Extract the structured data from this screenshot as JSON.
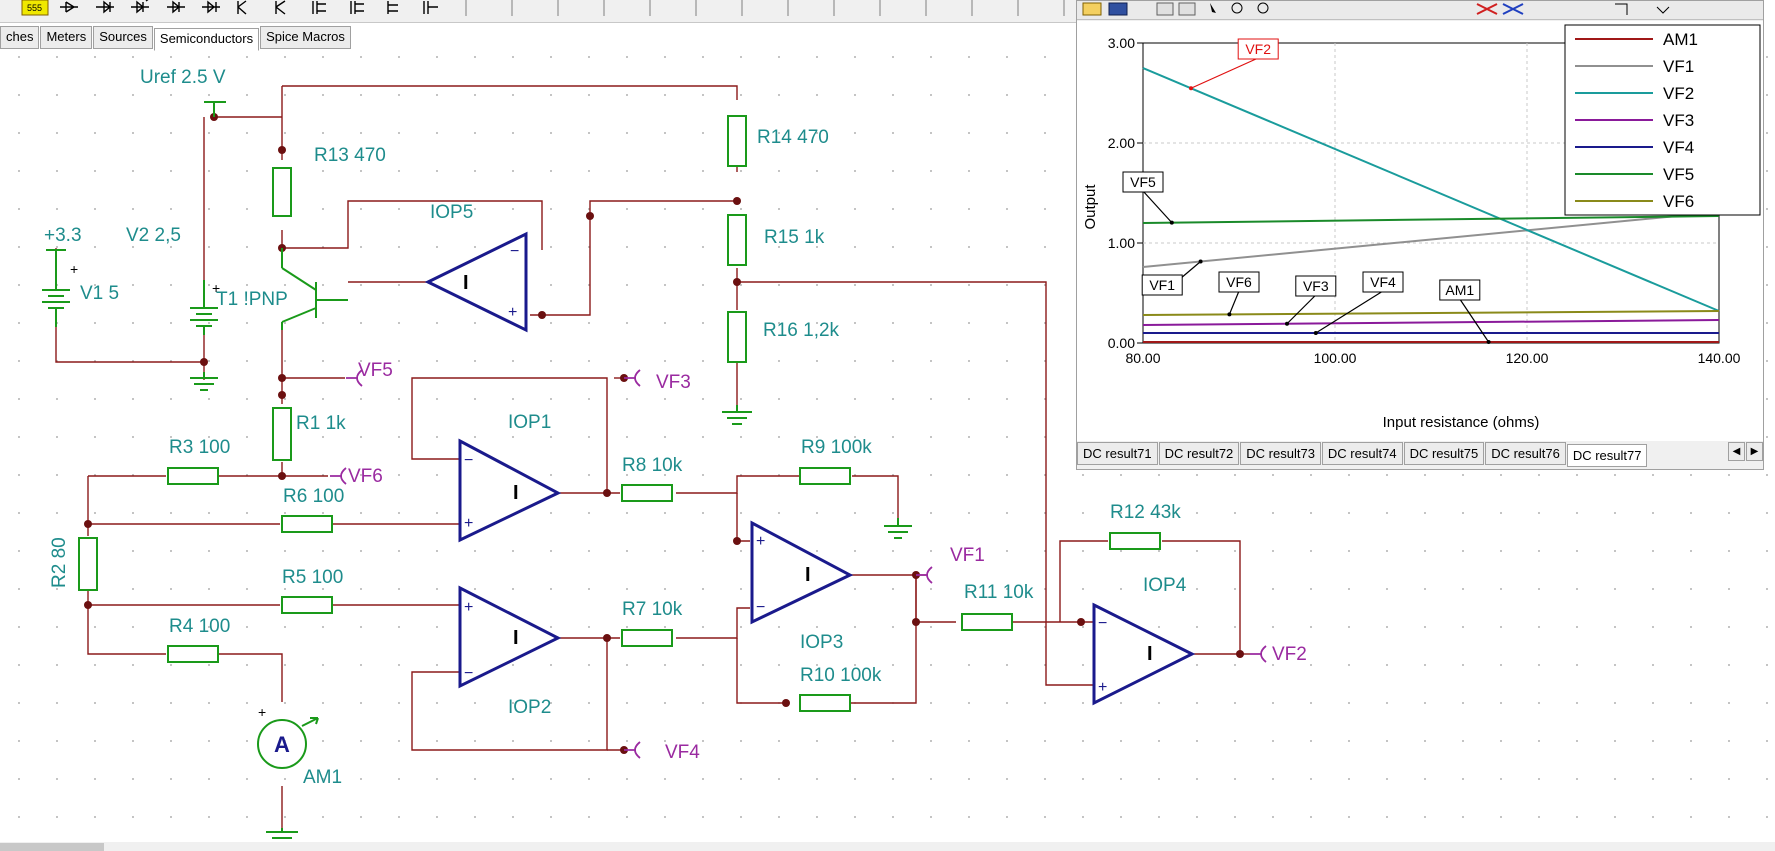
{
  "component_tabs": [
    "ches",
    "Meters",
    "Sources",
    "Semiconductors",
    "Spice Macros"
  ],
  "toolbar": {
    "badge": "555"
  },
  "schematic": {
    "components": {
      "uref": "Uref 2.5 V",
      "supply": "+3.3",
      "v1": "V1 5",
      "v2": "V2 2,5",
      "t1": "T1 !PNP",
      "r13": "R13 470",
      "r14": "R14 470",
      "r15": "R15 1k",
      "r16": "R16 1,2k",
      "r1": "R1 1k",
      "r3": "R3 100",
      "r6": "R6 100",
      "r5": "R5 100",
      "r4": "R4 100",
      "r2": "R2 80",
      "r8": "R8 10k",
      "r7": "R7 10k",
      "r9": "R9 100k",
      "r10": "R10 100k",
      "r11": "R11 10k",
      "r12": "R12 43k",
      "iop1": "IOP1",
      "iop2": "IOP2",
      "iop3": "IOP3",
      "iop4": "IOP4",
      "iop5": "IOP5",
      "am1": "AM1",
      "ammeter_symbol": "A",
      "opamp_symbol": "I"
    },
    "nets": {
      "vf1": "VF1",
      "vf2": "VF2",
      "vf3": "VF3",
      "vf4": "VF4",
      "vf5": "VF5",
      "vf6": "VF6"
    },
    "colors": {
      "wire": "#8b1a1a",
      "part": "#1a9a1a",
      "opamp": "#1a1a8c",
      "label": "#1e8c8c",
      "net": "#9a2aa0"
    }
  },
  "graph_window": {
    "result_tabs": [
      "DC result71",
      "DC result72",
      "DC result73",
      "DC result74",
      "DC result75",
      "DC result76",
      "DC result77"
    ],
    "active_tab": "DC result77",
    "nav": [
      "◀",
      "▶"
    ]
  },
  "chart_data": {
    "type": "line",
    "xlabel": "Input resistance (ohms)",
    "ylabel": "Output",
    "xlim": [
      80,
      140
    ],
    "ylim": [
      0,
      3
    ],
    "xticks": [
      "80.00",
      "100.00",
      "120.00",
      "140.00"
    ],
    "yticks": [
      "0.00",
      "1.00",
      "2.00",
      "3.00"
    ],
    "grid": true,
    "legend_position": "top-right",
    "series": [
      {
        "name": "AM1",
        "color": "#a01818",
        "x": [
          80,
          140
        ],
        "y": [
          0.01,
          0.01
        ]
      },
      {
        "name": "VF1",
        "color": "#909090",
        "x": [
          80,
          140
        ],
        "y": [
          0.76,
          1.31
        ]
      },
      {
        "name": "VF2",
        "color": "#1a9c9c",
        "x": [
          80,
          140
        ],
        "y": [
          2.75,
          0.32
        ]
      },
      {
        "name": "VF3",
        "color": "#8a1a9a",
        "x": [
          80,
          140
        ],
        "y": [
          0.18,
          0.23
        ]
      },
      {
        "name": "VF4",
        "color": "#1a1a8c",
        "x": [
          80,
          140
        ],
        "y": [
          0.1,
          0.1
        ]
      },
      {
        "name": "VF5",
        "color": "#1a8a2a",
        "x": [
          80,
          140
        ],
        "y": [
          1.2,
          1.27
        ]
      },
      {
        "name": "VF6",
        "color": "#8a8a1a",
        "x": [
          80,
          140
        ],
        "y": [
          0.28,
          0.32
        ]
      }
    ],
    "annotations": [
      {
        "text": "VF2",
        "style": "red"
      },
      {
        "text": "VF5",
        "style": "black"
      },
      {
        "text": "VF1",
        "style": "black"
      },
      {
        "text": "VF6",
        "style": "black"
      },
      {
        "text": "VF3",
        "style": "black"
      },
      {
        "text": "VF4",
        "style": "black"
      },
      {
        "text": "AM1",
        "style": "black"
      }
    ]
  }
}
